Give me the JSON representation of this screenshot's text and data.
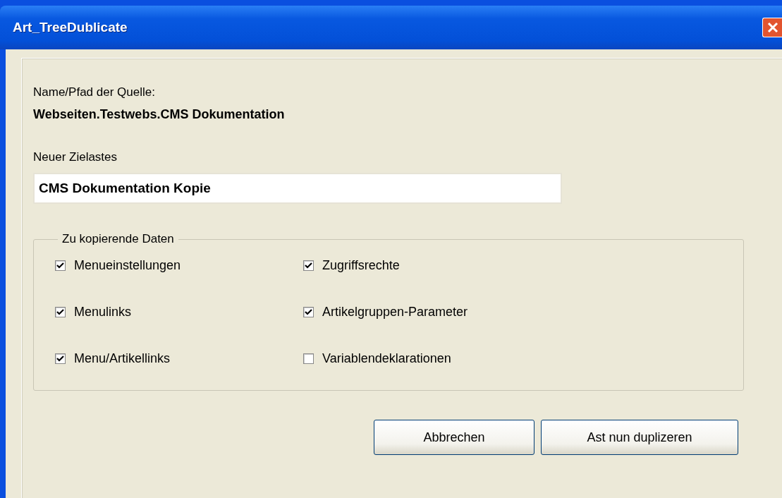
{
  "window": {
    "title": "Art_TreeDublicate"
  },
  "source": {
    "label": "Name/Pfad der Quelle:",
    "value": "Webseiten.Testwebs.CMS Dokumentation"
  },
  "target": {
    "label": "Neuer Zielastes",
    "value": "CMS Dokumentation Kopie"
  },
  "group": {
    "legend": "Zu kopierende Daten",
    "options": [
      {
        "label": "Menueinstellungen",
        "checked": true
      },
      {
        "label": "Zugriffsrechte",
        "checked": true
      },
      {
        "label": "Menulinks",
        "checked": true
      },
      {
        "label": "Artikelgruppen-Parameter",
        "checked": true
      },
      {
        "label": "Menu/Artikellinks",
        "checked": true
      },
      {
        "label": "Variablendeklarationen",
        "checked": false
      }
    ]
  },
  "buttons": [
    "Abbrechen",
    "Ast nun duplizeren"
  ]
}
